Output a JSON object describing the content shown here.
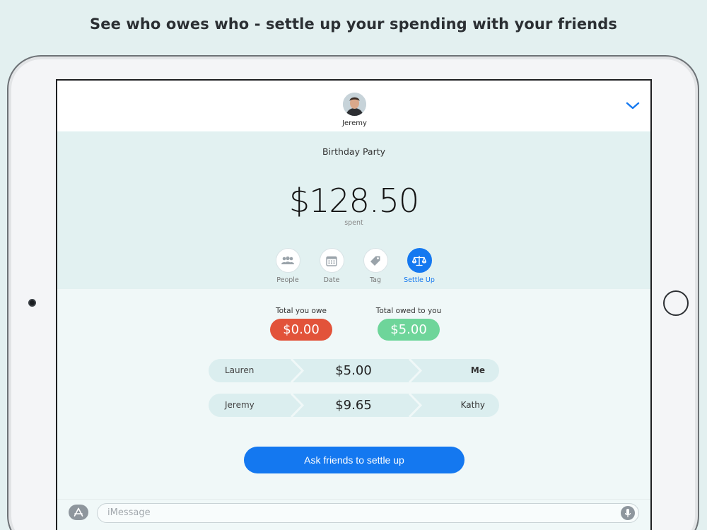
{
  "headline": "See who owes who - settle up your spending with your friends",
  "header": {
    "contact_name": "Jeremy",
    "chevron_icon": "chevron-down-icon"
  },
  "summary": {
    "event_title": "Birthday Party",
    "amount": "$128.50",
    "amount_caption": "spent"
  },
  "tabs": [
    {
      "label": "People",
      "icon": "people-icon",
      "active": false
    },
    {
      "label": "Date",
      "icon": "calendar-icon",
      "active": false
    },
    {
      "label": "Tag",
      "icon": "tag-icon",
      "active": false
    },
    {
      "label": "Settle Up",
      "icon": "scales-icon",
      "active": true
    }
  ],
  "totals": {
    "you_owe_label": "Total you owe",
    "you_owe_value": "$0.00",
    "owed_to_you_label": "Total owed to you",
    "owed_to_you_value": "$5.00"
  },
  "debts": [
    {
      "from": "Lauren",
      "amount": "$5.00",
      "to": "Me"
    },
    {
      "from": "Jeremy",
      "amount": "$9.65",
      "to": "Kathy"
    }
  ],
  "actions": {
    "settle_button": "Ask friends to settle up"
  },
  "imessage": {
    "placeholder": "iMessage"
  },
  "colors": {
    "accent": "#1478f0",
    "owe_red": "#e2533a",
    "owed_green": "#6ed59a",
    "background": "#e3f0f0"
  }
}
